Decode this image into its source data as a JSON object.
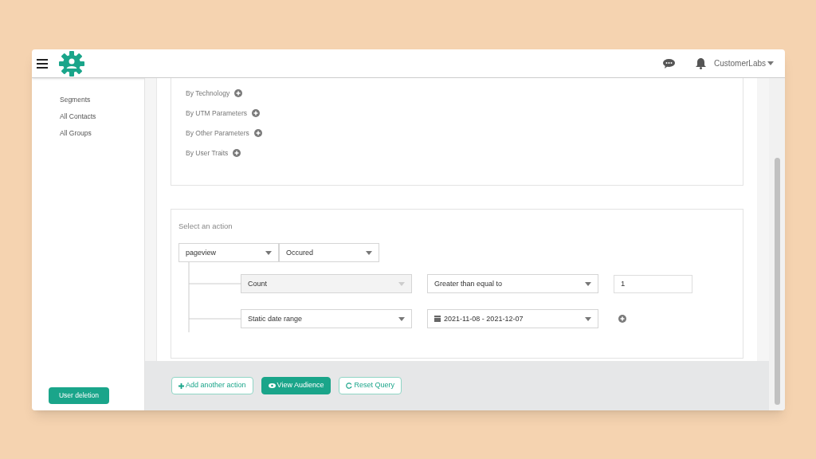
{
  "header": {
    "account": "CustomerLabs"
  },
  "sidebar": {
    "items": [
      {
        "label": "Segments"
      },
      {
        "label": "All Contacts"
      },
      {
        "label": "All Groups"
      }
    ],
    "button": "User deletion"
  },
  "filters": [
    {
      "label": "By Technology"
    },
    {
      "label": "By UTM Parameters"
    },
    {
      "label": "By Other Parameters"
    },
    {
      "label": "By User Traits"
    }
  ],
  "action": {
    "title": "Select an action",
    "event": "pageview",
    "occurrence": "Occured",
    "conditions": [
      {
        "kind": "count",
        "field": "Count",
        "field_disabled": true,
        "operator": "Greater than equal to",
        "value": "1"
      },
      {
        "kind": "date",
        "field": "Static date range",
        "field_disabled": false,
        "range": "2021-11-08 - 2021-12-07"
      }
    ]
  },
  "footer": {
    "buttons": [
      {
        "kind": "add",
        "label": "Add another action",
        "primary": false
      },
      {
        "kind": "view",
        "label": "View Audience",
        "primary": true
      },
      {
        "kind": "reset",
        "label": "Reset Query",
        "primary": false
      }
    ]
  }
}
